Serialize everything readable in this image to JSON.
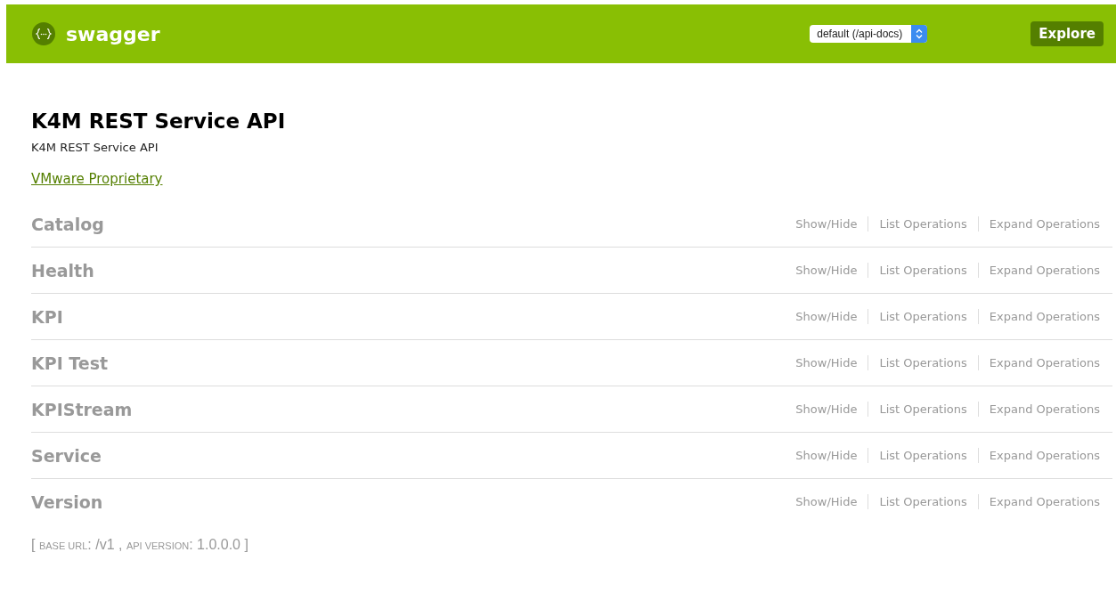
{
  "header": {
    "logo_text": "swagger",
    "spec_select": "default (/api-docs)",
    "explore_button": "Explore"
  },
  "info": {
    "title": "K4M REST Service API",
    "description": "K4M REST Service API",
    "license_link": "VMware Proprietary"
  },
  "resources": [
    {
      "name": "Catalog",
      "actions": [
        "Show/Hide",
        "List Operations",
        "Expand Operations"
      ]
    },
    {
      "name": "Health",
      "actions": [
        "Show/Hide",
        "List Operations",
        "Expand Operations"
      ]
    },
    {
      "name": "KPI",
      "actions": [
        "Show/Hide",
        "List Operations",
        "Expand Operations"
      ]
    },
    {
      "name": "KPI Test",
      "actions": [
        "Show/Hide",
        "List Operations",
        "Expand Operations"
      ]
    },
    {
      "name": "KPIStream",
      "actions": [
        "Show/Hide",
        "List Operations",
        "Expand Operations"
      ]
    },
    {
      "name": "Service",
      "actions": [
        "Show/Hide",
        "List Operations",
        "Expand Operations"
      ]
    },
    {
      "name": "Version",
      "actions": [
        "Show/Hide",
        "List Operations",
        "Expand Operations"
      ]
    }
  ],
  "footer": [
    {
      "kind": "plain",
      "text": "[ "
    },
    {
      "kind": "label",
      "text": "BASE URL"
    },
    {
      "kind": "plain",
      "text": ": /v1 , "
    },
    {
      "kind": "label",
      "text": "API VERSION"
    },
    {
      "kind": "plain",
      "text": ": 1.0.0.0 ]"
    }
  ]
}
